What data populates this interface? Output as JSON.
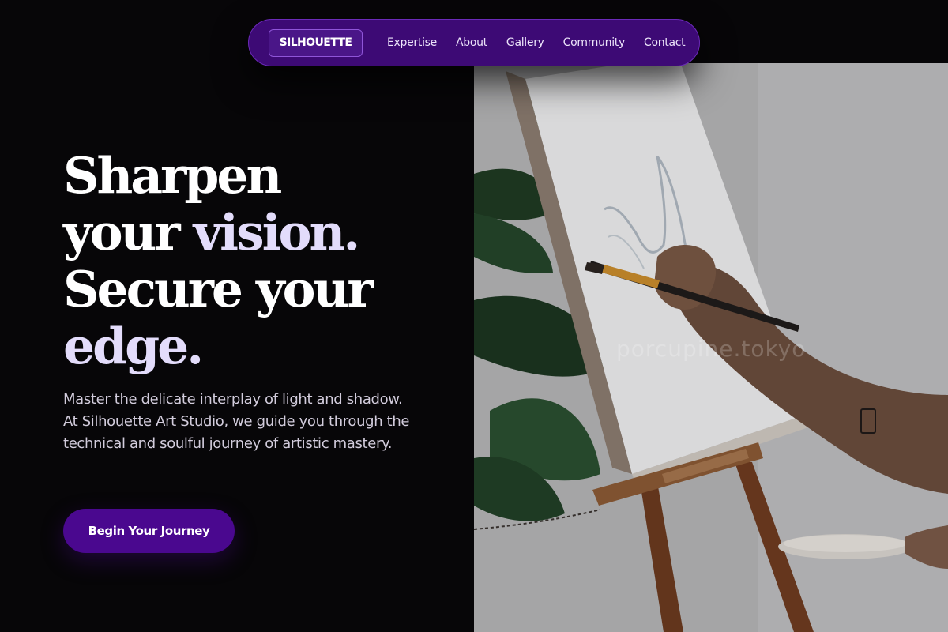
{
  "nav": {
    "brand": "SILHOUETTE",
    "links": [
      "Expertise",
      "About",
      "Gallery",
      "Community",
      "Contact"
    ]
  },
  "hero": {
    "headline": {
      "line1": "Sharpen",
      "line2_a": "your ",
      "line2_b": "vision.",
      "line3": "Secure your",
      "line4": "edge."
    },
    "description": "Master the delicate interplay of light and shadow. At Silhouette Art Studio, we guide you through the technical and soulful journey of artistic mastery.",
    "cta_label": "Begin Your Journey"
  },
  "image": {
    "alt": "Hand painting on a canvas at an easel",
    "watermark": "porcupine.tokyo"
  },
  "colors": {
    "background": "#070608",
    "nav_bg": "#3d0a75",
    "accent": "#4a088f",
    "headline_accent": "#e3dcfb"
  }
}
